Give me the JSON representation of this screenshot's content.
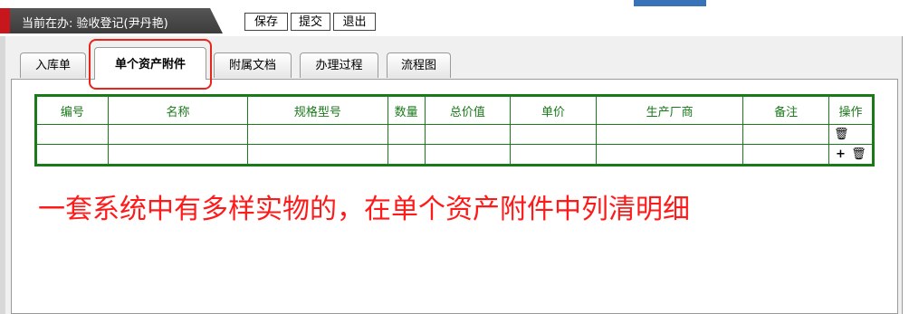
{
  "header": {
    "title": "当前在办: 验收登记(尹丹艳)",
    "buttons": [
      "保存",
      "提交",
      "退出"
    ]
  },
  "tabs": [
    {
      "label": "入库单",
      "active": false
    },
    {
      "label": "单个资产附件",
      "active": true
    },
    {
      "label": "附属文档",
      "active": false
    },
    {
      "label": "办理过程",
      "active": false
    },
    {
      "label": "流程图",
      "active": false
    }
  ],
  "table": {
    "columns": [
      "编号",
      "名称",
      "规格型号",
      "数量",
      "总价值",
      "单价",
      "生产厂商",
      "备注",
      "操作"
    ],
    "rows": [
      {
        "cells": [
          "",
          "",
          "",
          "",
          "",
          "",
          "",
          ""
        ],
        "actions": [
          "trash-icon"
        ]
      },
      {
        "cells": [
          "",
          "",
          "",
          "",
          "",
          "",
          "",
          ""
        ],
        "actions": [
          "plus-icon",
          "trash-icon"
        ]
      }
    ]
  },
  "icons": {
    "trash": "🗑",
    "plus": "+"
  },
  "annotation": {
    "text": "一套系统中有多样实物的，在单个资产附件中列清明细",
    "color": "#ff1a1a"
  },
  "colors": {
    "accent_red": "#c8161d",
    "table_green": "#1a7a1a",
    "highlight_red": "#e8241b",
    "top_blue": "#3a72b8"
  }
}
